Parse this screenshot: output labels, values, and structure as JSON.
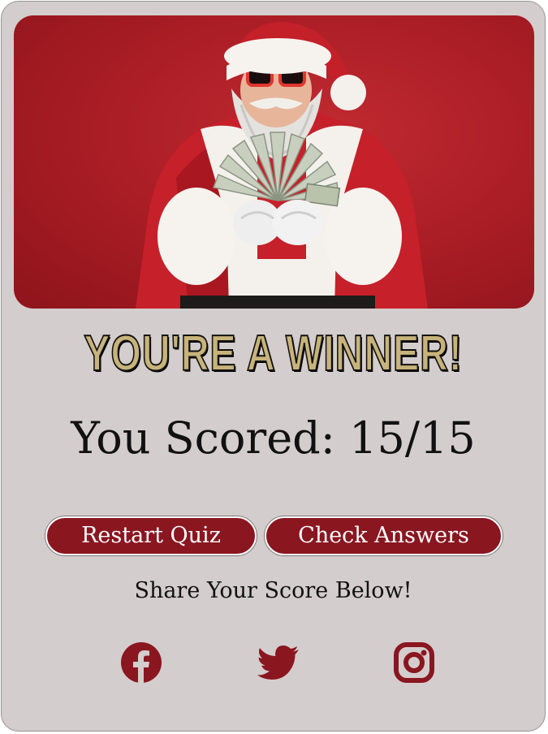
{
  "result": {
    "headline": "YOU'RE A WINNER!",
    "score_text": "You Scored: 15/15",
    "score": 15,
    "total": 15
  },
  "buttons": {
    "restart_label": "Restart Quiz",
    "check_label": "Check Answers"
  },
  "share": {
    "prompt": "Share Your Score Below!",
    "icons": [
      "facebook-icon",
      "twitter-icon",
      "instagram-icon"
    ]
  },
  "colors": {
    "card_background": "#d4cdcd",
    "accent": "#8a1620",
    "headline_fill": "#c8b37a",
    "hero_background": "#b3222a"
  },
  "hero": {
    "subject": "santa-with-sunglasses-holding-cash"
  }
}
